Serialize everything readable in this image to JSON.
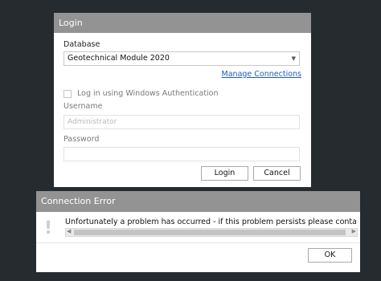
{
  "login": {
    "title": "Login",
    "database_label": "Database",
    "database_value": "Geotechnical Module 2020",
    "manage_connections": "Manage Connections",
    "windows_auth_label": "Log in using Windows Authentication",
    "windows_auth_checked": false,
    "username_label": "Username",
    "username_placeholder": "Administrator",
    "password_label": "Password",
    "password_value": "",
    "login_button": "Login",
    "cancel_button": "Cancel"
  },
  "error": {
    "title": "Connection Error",
    "icon": "exclamation-icon",
    "message": "Unfortunately a problem has occurred - if this problem persists please contact support",
    "ok_button": "OK"
  },
  "colors": {
    "background": "#262b30",
    "titlebar": "#939393",
    "link": "#1e5bbf"
  }
}
